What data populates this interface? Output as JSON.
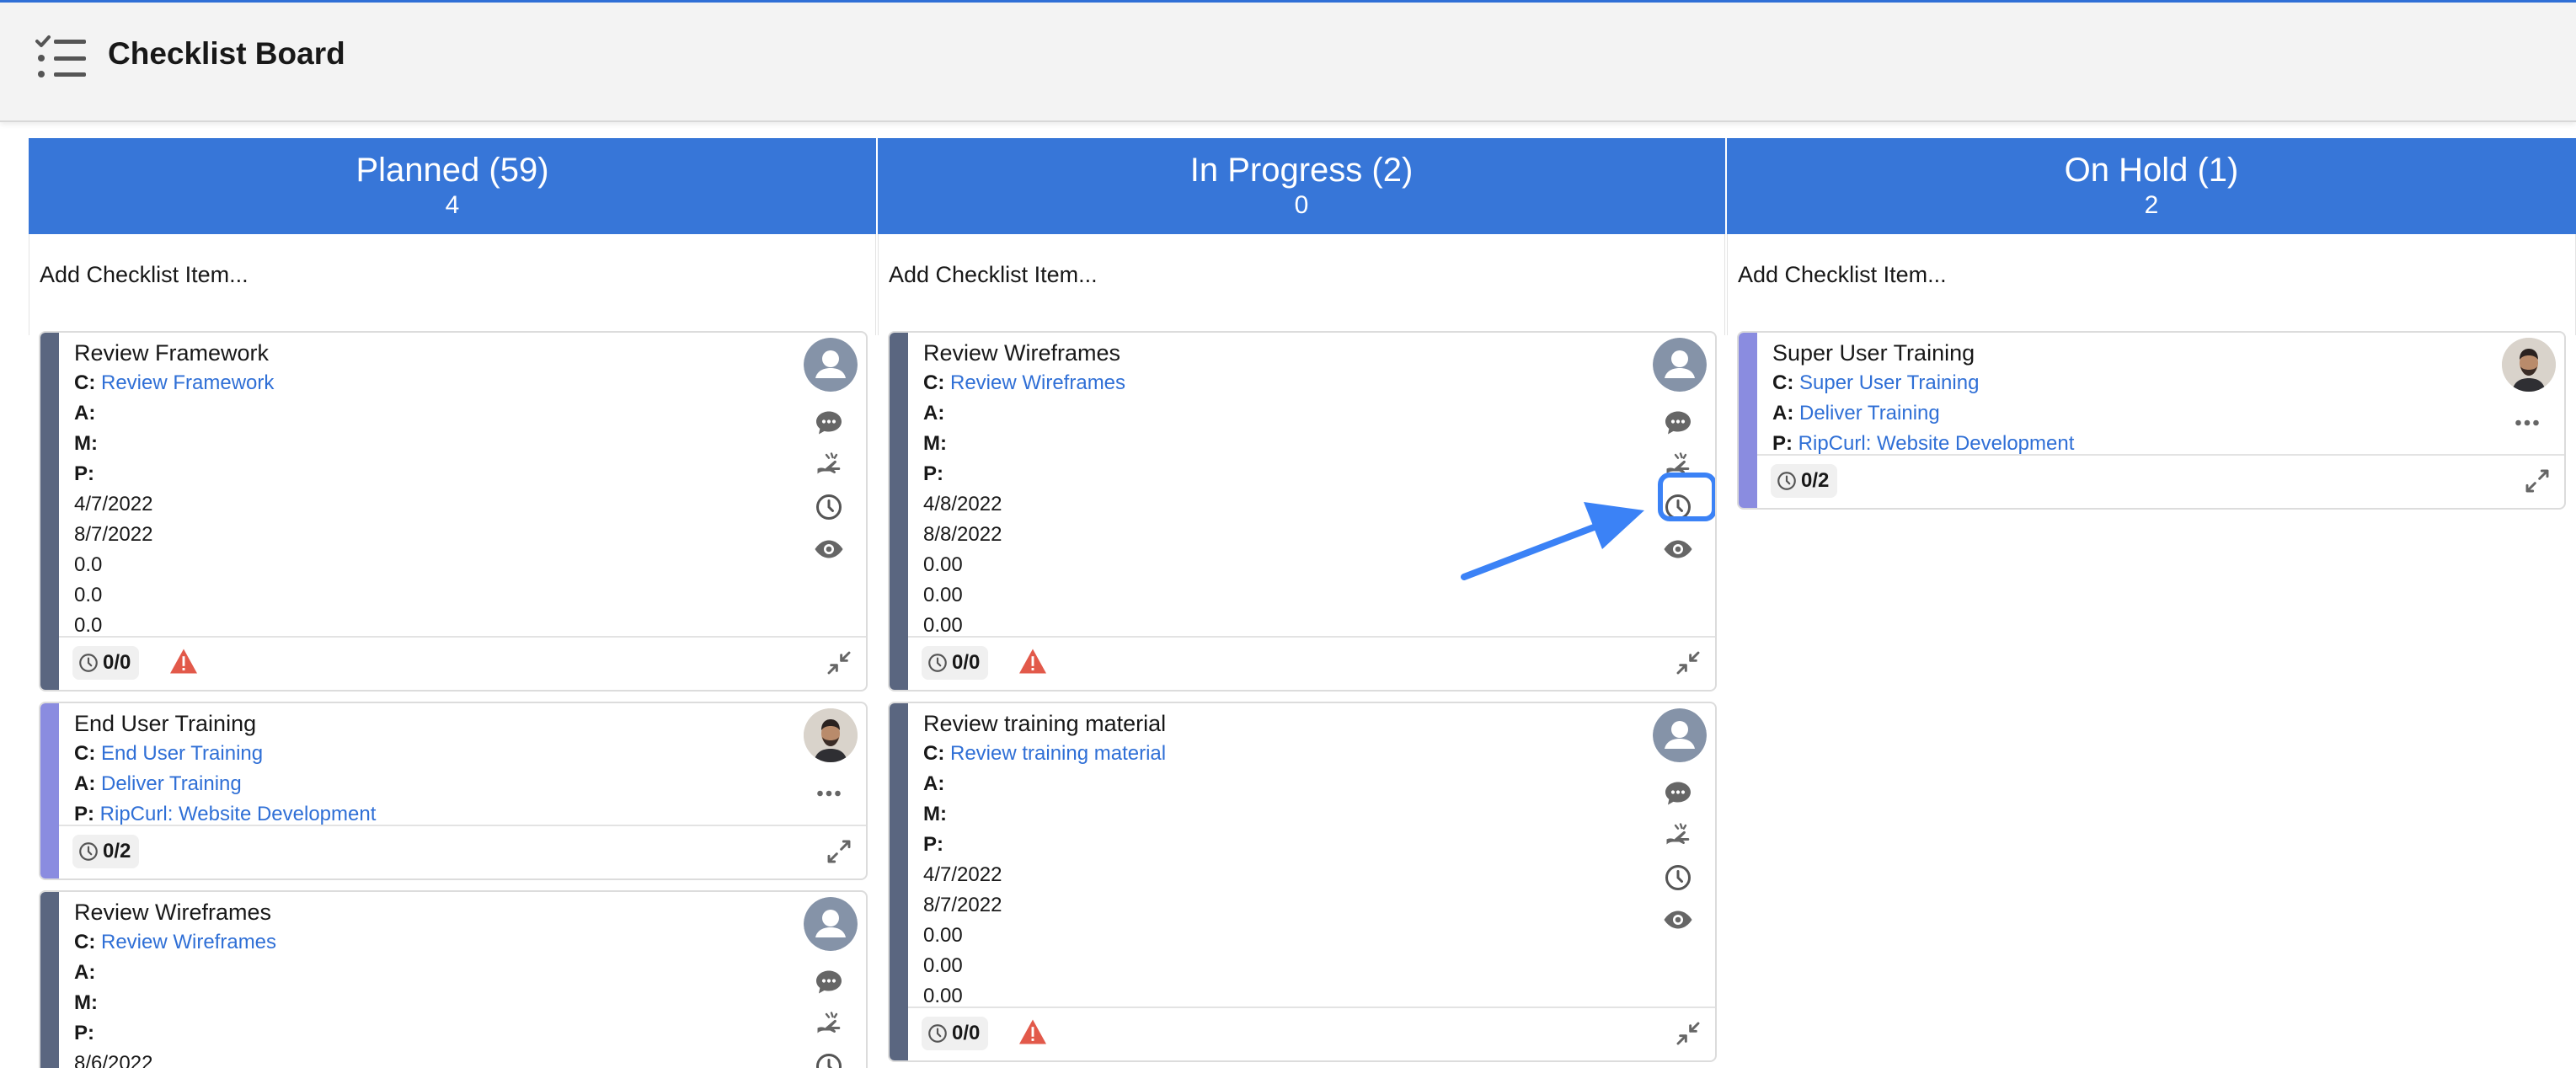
{
  "app": {
    "title": "Checklist Board",
    "icon": "checklist-icon"
  },
  "columns": [
    {
      "title": "Planned (59)",
      "count": "4",
      "add_label": "Add Checklist Item..."
    },
    {
      "title": "In Progress (2)",
      "count": "0",
      "add_label": "Add Checklist Item..."
    },
    {
      "title": "On Hold (1)",
      "count": "2",
      "add_label": "Add Checklist Item..."
    }
  ],
  "labels": {
    "c": "C:",
    "a": "A:",
    "m": "M:",
    "p": "P:"
  },
  "cards": {
    "planned": [
      {
        "title": "Review Framework",
        "c": "Review Framework",
        "date1": "4/7/2022",
        "date2": "8/7/2022",
        "v1": "0.0",
        "v2": "0.0",
        "v3": "0.0",
        "progress": "0/0"
      },
      {
        "title": "End User Training",
        "c": "End User Training",
        "a": "Deliver Training",
        "p": "RipCurl: Website Development",
        "progress": "0/2"
      },
      {
        "title": "Review Wireframes",
        "c": "Review Wireframes",
        "date1": "8/6/2022"
      }
    ],
    "in_progress": [
      {
        "title": "Review Wireframes",
        "c": "Review Wireframes",
        "date1": "4/8/2022",
        "date2": "8/8/2022",
        "v1": "0.00",
        "v2": "0.00",
        "v3": "0.00",
        "progress": "0/0"
      },
      {
        "title": "Review training material",
        "c": "Review training material",
        "date1": "4/7/2022",
        "date2": "8/7/2022",
        "v1": "0.00",
        "v2": "0.00",
        "v3": "0.00",
        "progress": "0/0"
      }
    ],
    "on_hold": [
      {
        "title": "Super User Training",
        "c": "Super User Training",
        "a": "Deliver Training",
        "p": "RipCurl: Website Development",
        "progress": "0/2"
      }
    ]
  },
  "colors": {
    "header_blue": "#3776d8",
    "bar_dark": "#5a6680",
    "bar_purple": "#8a8ce0",
    "link": "#2f6fd6",
    "warning": "#e2594a",
    "annotation": "#3b82f6"
  }
}
